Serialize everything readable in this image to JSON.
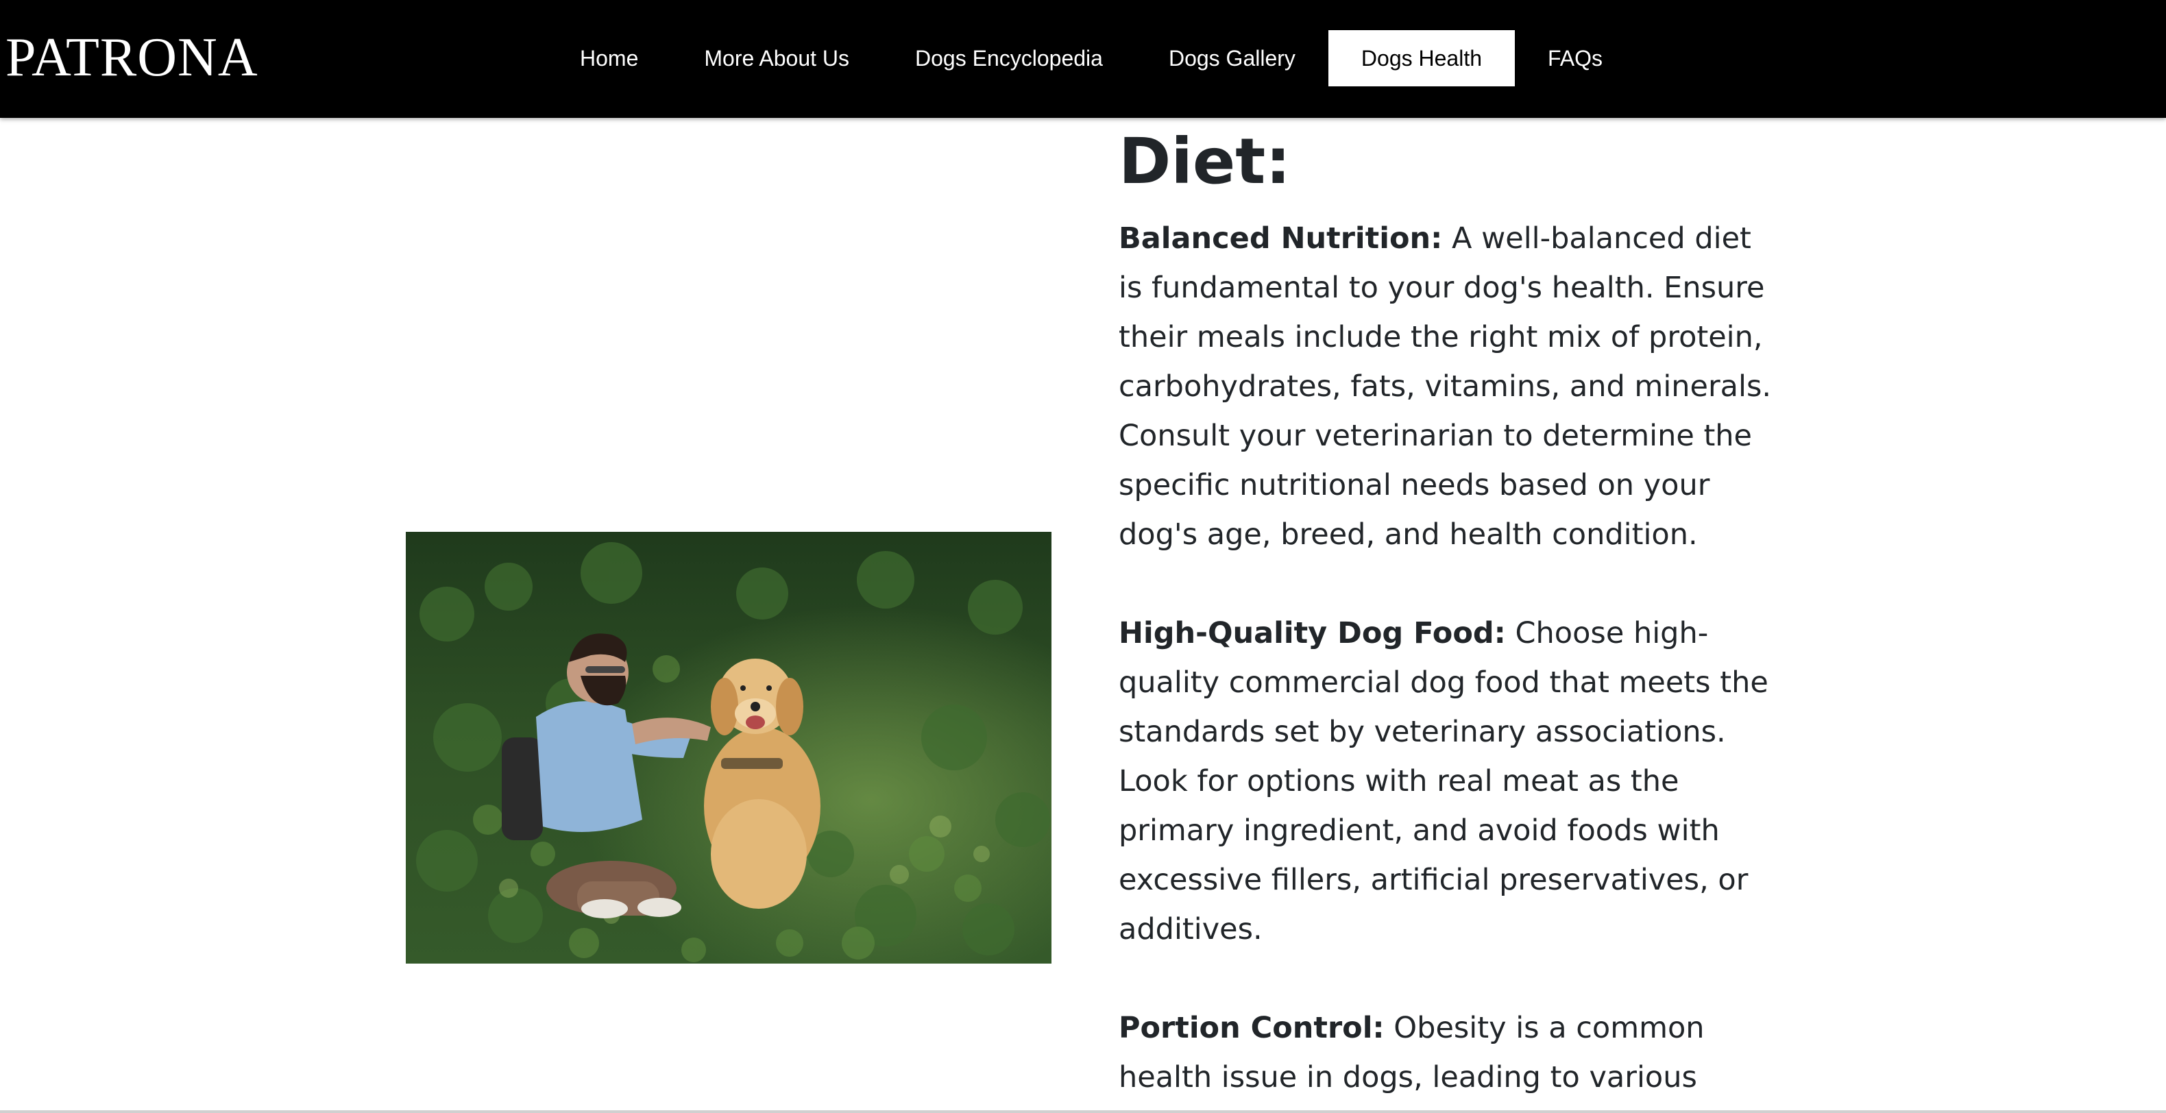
{
  "brand": "PATRONA",
  "nav": {
    "items": [
      {
        "label": "Home"
      },
      {
        "label": "More About Us"
      },
      {
        "label": "Dogs Encyclopedia"
      },
      {
        "label": "Dogs Gallery"
      },
      {
        "label": "Dogs Health"
      },
      {
        "label": "FAQs"
      }
    ],
    "active": "Dogs Health"
  },
  "section": {
    "title": "Diet:",
    "paragraphs": [
      {
        "heading": "Balanced Nutrition:",
        "text": " A well-balanced diet is fundamental to your dog's health. Ensure their meals include the right mix of protein, carbohydrates, fats, vitamins, and minerals. Consult your veterinarian to determine the specific nutritional needs based on your dog's age, breed, and health condition."
      },
      {
        "heading": "High-Quality Dog Food:",
        "text": " Choose high-quality commercial dog food that meets the standards set by veterinary associations. Look for options with real meat as the primary ingredient, and avoid foods with excessive fillers, artificial preservatives, or additives."
      },
      {
        "heading": "Portion Control:",
        "text": " Obesity is a common health issue in dogs, leading to various"
      }
    ]
  },
  "colors": {
    "navbar_bg": "#000000",
    "active_nav_bg": "#ffffff",
    "text": "#212529"
  }
}
